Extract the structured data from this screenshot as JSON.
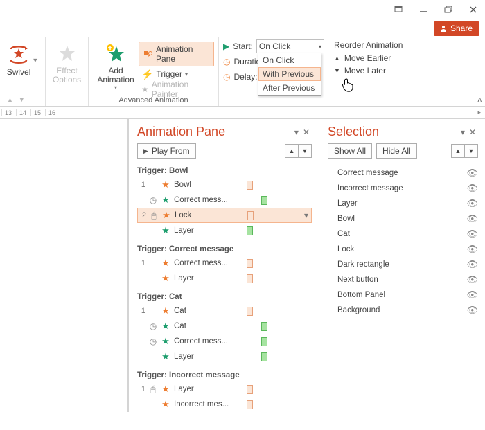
{
  "window": {
    "share": "Share"
  },
  "ribbon": {
    "swivel": "Swivel",
    "effect_options": "Effect\nOptions",
    "add_animation": "Add\nAnimation",
    "anim_pane": "Animation Pane",
    "trigger": "Trigger",
    "painter": "Animation Painter",
    "group_adv": "Advanced Animation",
    "start": "Start:",
    "duration": "Duration:",
    "delay": "Delay:",
    "start_value": "On Click",
    "dd_onclick": "On Click",
    "dd_withprev": "With Previous",
    "dd_afterprev": "After Previous",
    "reorder": "Reorder Animation",
    "move_earlier": "Move Earlier",
    "move_later": "Move Later"
  },
  "ruler": [
    "13",
    "14",
    "15",
    "16"
  ],
  "ap": {
    "title": "Animation Pane",
    "play": "Play From",
    "triggers": {
      "bowl": "Trigger: Bowl",
      "correct": "Trigger: Correct message",
      "cat": "Trigger: Cat",
      "incorrect": "Trigger: Incorrect message"
    },
    "items": {
      "bowl_1": {
        "n": "1",
        "name": "Bowl"
      },
      "bowl_2": {
        "name": "Correct mess..."
      },
      "bowl_3": {
        "n": "2",
        "name": "Lock"
      },
      "bowl_4": {
        "name": "Layer"
      },
      "cm_1": {
        "n": "1",
        "name": "Correct mess..."
      },
      "cm_2": {
        "name": "Layer"
      },
      "cat_1": {
        "n": "1",
        "name": "Cat"
      },
      "cat_2": {
        "name": "Cat"
      },
      "cat_3": {
        "name": "Correct mess..."
      },
      "cat_4": {
        "name": "Layer"
      },
      "im_1": {
        "n": "1",
        "name": "Layer"
      },
      "im_2": {
        "name": "Incorrect mes..."
      }
    }
  },
  "sel": {
    "title": "Selection",
    "show_all": "Show All",
    "hide_all": "Hide All",
    "items": [
      "Correct message",
      "Incorrect message",
      "Layer",
      "Bowl",
      "Cat",
      "Lock",
      "Dark rectangle",
      "Next button",
      "Bottom Panel",
      "Background"
    ]
  }
}
